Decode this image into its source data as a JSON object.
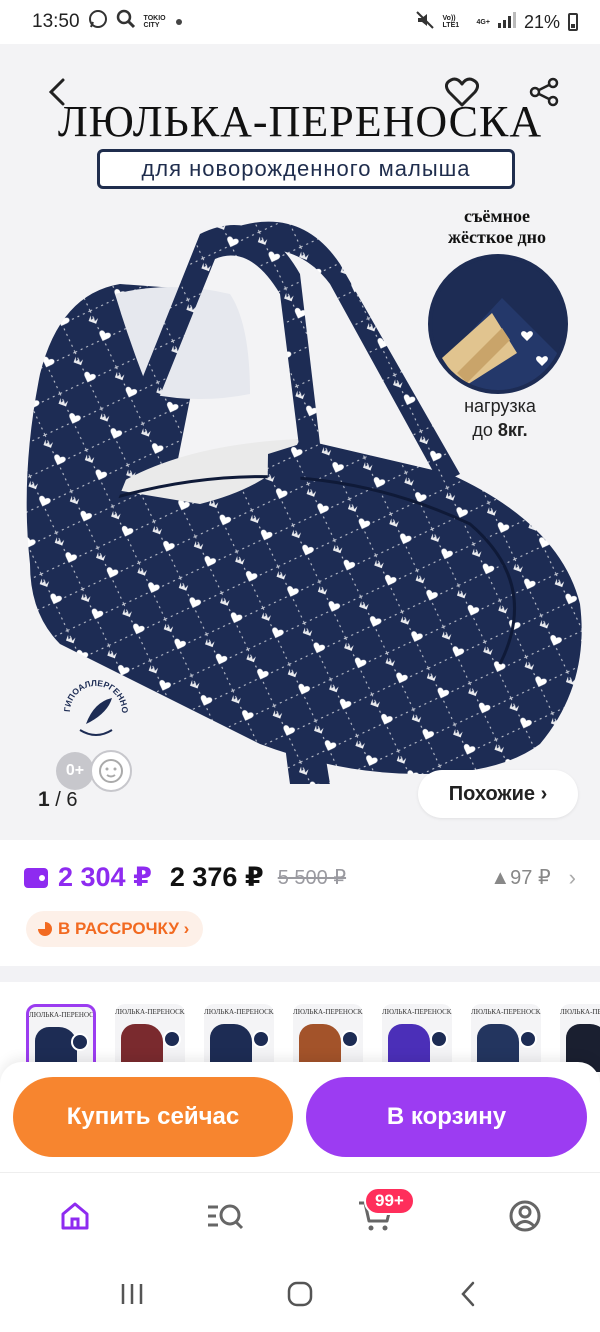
{
  "status_bar": {
    "time": "13:50",
    "city_text": "TOKIO CITY",
    "network": "Vo)) LTE1",
    "network_gen": "4G+",
    "battery": "21%"
  },
  "hero": {
    "title": "ЛЮЛЬКА-ПЕРЕНОСКА",
    "subtitle": "для новорожденного малыша",
    "feature_label_line1": "съёмное",
    "feature_label_line2": "жёсткое дно",
    "load_line1": "нагрузка",
    "load_prefix": "до ",
    "load_value": "8кг.",
    "hypo_text": "ГИПОАЛЛЕРГЕННО",
    "age_badge": "0+",
    "counter_current": "1",
    "counter_total": "/ 6",
    "similar_button": "Похожие ›"
  },
  "price": {
    "card_price": "2 304 ₽",
    "price": "2 376 ₽",
    "old_price": "5 500 ₽",
    "delta": "▲97 ₽",
    "installment": "В РАССРОЧКУ ›"
  },
  "thumbnails": [
    {
      "title": "ЛЮЛЬКА-ПЕРЕНОСКА",
      "color": "#1d2c54",
      "selected": true
    },
    {
      "title": "ЛЮЛЬКА-ПЕРЕНОСКА",
      "color": "#7a2a2e",
      "selected": false
    },
    {
      "title": "ЛЮЛЬКА-ПЕРЕНОСКА",
      "color": "#1d2c54",
      "selected": false
    },
    {
      "title": "ЛЮЛЬКА-ПЕРЕНОСКА",
      "color": "#a3532a",
      "selected": false
    },
    {
      "title": "ЛЮЛЬКА-ПЕРЕНОСКА",
      "color": "#4b2fb8",
      "selected": false
    },
    {
      "title": "ЛЮЛЬКА-ПЕРЕНОСКА",
      "color": "#23355f",
      "selected": false
    },
    {
      "title": "ЛЮЛЬКА-ПЕРЕНОСКА",
      "color": "#1a1f30",
      "selected": false
    }
  ],
  "actions": {
    "buy_now": "Купить сейчас",
    "add_to_cart": "В корзину"
  },
  "tabbar": {
    "cart_badge": "99+",
    "active_color": "#8e2bf0"
  },
  "colors": {
    "accent": "#8e2bf0",
    "orange": "#f7852f",
    "navy": "#1d2c54"
  }
}
